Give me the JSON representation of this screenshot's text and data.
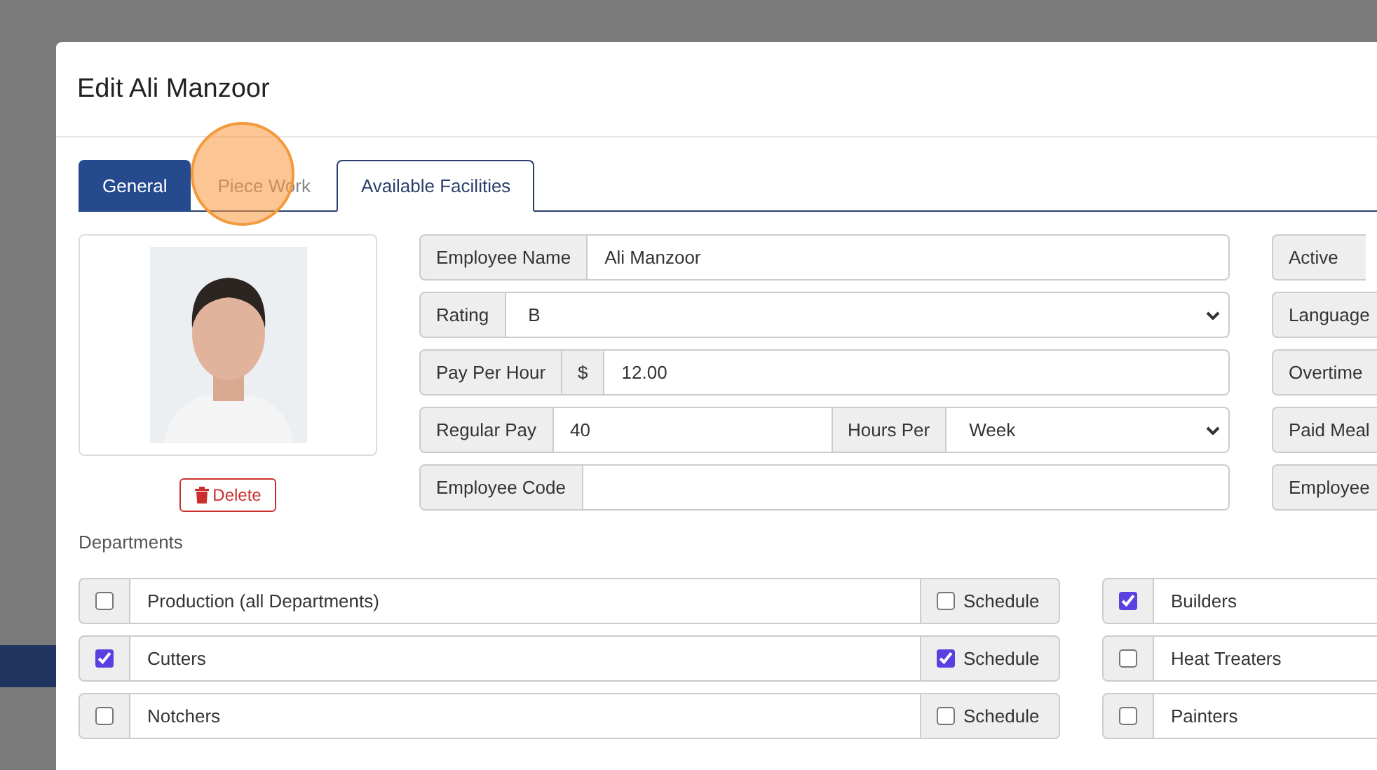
{
  "dialog": {
    "title": "Edit Ali Manzoor"
  },
  "tabs": [
    {
      "label": "General",
      "selected": true,
      "outlined": false
    },
    {
      "label": "Piece Work",
      "selected": false,
      "outlined": false
    },
    {
      "label": "Available Facilities",
      "selected": false,
      "outlined": true
    }
  ],
  "photo": {
    "kind": "picture",
    "delete_button": "Delete"
  },
  "fields": [
    {
      "kind": "text",
      "label": "Employee Name",
      "value": "Ali Manzoor"
    },
    {
      "kind": "select",
      "label": "Rating",
      "value": "B"
    },
    {
      "kind": "currency",
      "label": "Pay Per Hour",
      "prefix": "$",
      "value": "12.00"
    },
    {
      "kind": "split",
      "label": "Regular Pay",
      "value": "40",
      "label2": "Hours Per",
      "value2": "Week"
    },
    {
      "kind": "text",
      "label": "Employee Code"
    }
  ],
  "side_fields": [
    "Active",
    "Language",
    "Overtime",
    "Paid Meal",
    "Employee"
  ],
  "departments_label": "Departments",
  "departments": [
    {
      "name": "Production (all Departments)",
      "checked": false,
      "schedule": {
        "label": "Schedule",
        "checked": false
      }
    },
    {
      "name": "Cutters",
      "checked": true,
      "schedule": {
        "label": "Schedule",
        "checked": true
      }
    },
    {
      "name": "Notchers",
      "checked": false,
      "schedule": {
        "label": "Schedule",
        "checked": false
      }
    }
  ],
  "departments_right": [
    {
      "name": "Builders",
      "checked": true
    },
    {
      "name": "Heat Treaters",
      "checked": false
    },
    {
      "name": "Painters",
      "checked": false
    }
  ]
}
